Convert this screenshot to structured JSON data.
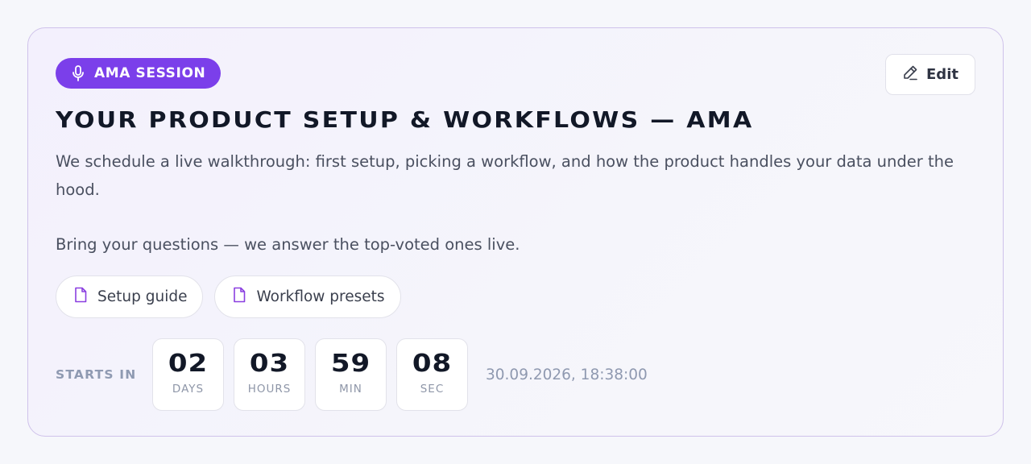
{
  "badge": {
    "label": "AMA SESSION",
    "icon": "microphone-icon",
    "color": "#7b3fea"
  },
  "edit_button": {
    "label": "Edit",
    "icon": "pencil-icon"
  },
  "title": "YOUR PRODUCT SETUP & WORKFLOWS — AMA",
  "description": {
    "paragraph1": "We schedule a live walkthrough: first setup, picking a workflow, and how the product handles your data under the hood.",
    "paragraph2": "Bring your questions — we answer the top-voted ones live."
  },
  "resources": [
    {
      "label": "Setup guide",
      "icon": "document-icon"
    },
    {
      "label": "Workflow presets",
      "icon": "document-icon"
    }
  ],
  "countdown": {
    "label": "STARTS IN",
    "units": [
      {
        "value": "02",
        "unit": "DAYS"
      },
      {
        "value": "03",
        "unit": "HOURS"
      },
      {
        "value": "59",
        "unit": "MIN"
      },
      {
        "value": "08",
        "unit": "SEC"
      }
    ],
    "datetime": "30.09.2026, 18:38:00"
  }
}
